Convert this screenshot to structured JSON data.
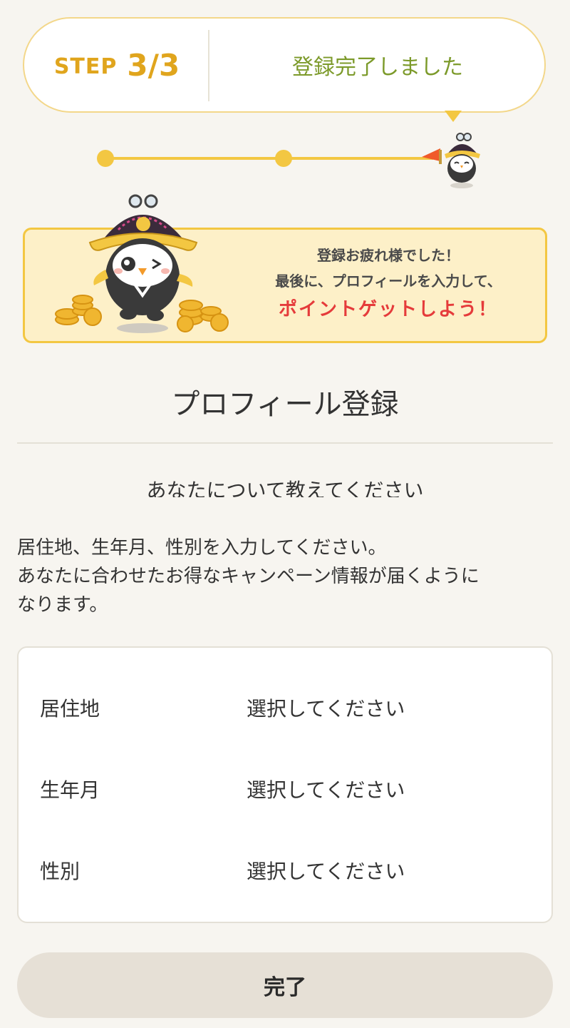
{
  "step": {
    "word": "STEP",
    "number": "3/3",
    "message": "登録完了しました",
    "current_step": 3,
    "total_steps": 3
  },
  "banner": {
    "line1": "登録お疲れ様でした！",
    "line2": "最後に、プロフィールを入力して、",
    "emphasis": "ポイントゲットしよう！"
  },
  "page_title": "プロフィール登録",
  "subtitle": "あなたについて教えてください",
  "description": {
    "line1": "居住地、生年月、性別を入力してください。",
    "line2": "あなたに合わせたお得なキャンペーン情報が届くように",
    "line3": "なります。"
  },
  "form": {
    "fields": [
      {
        "label": "居住地",
        "value": "選択してください"
      },
      {
        "label": "生年月",
        "value": "選択してください"
      },
      {
        "label": "性別",
        "value": "選択してください"
      }
    ]
  },
  "submit_label": "完了",
  "icons": {
    "mascot_small": "owl-mascot-icon",
    "mascot_big": "owl-mascot-with-coins-icon"
  },
  "colors": {
    "accent_yellow": "#f3c742",
    "step_text": "#e0a51d",
    "message_green": "#7c9a2a",
    "emphasis_red": "#e53b3b"
  }
}
